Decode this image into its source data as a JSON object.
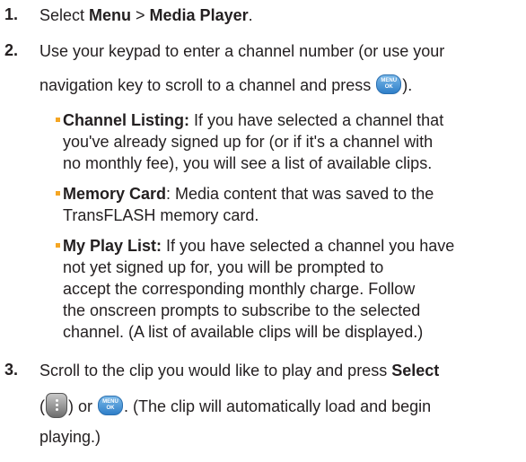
{
  "steps": [
    {
      "number": "1.",
      "lines": [
        {
          "before": "Select ",
          "bold1": "Menu",
          "mid": " > ",
          "bold2": "Media Player",
          "after": "."
        }
      ]
    },
    {
      "number": "2.",
      "line1": "Use your keypad to enter a channel number (or use your",
      "line2_before": "navigation key to scroll to a channel and press ",
      "line2_after": ")."
    },
    {
      "number": "3.",
      "line1_before": "Scroll to the clip you would like to play and press ",
      "line1_bold": "Select",
      "line2_open": "(",
      "line2_mid": ") or ",
      "line2_after": ". (The clip will automatically load and begin",
      "line3": "playing.)"
    }
  ],
  "bullets": [
    {
      "term": "Channel Listing:",
      "lines": [
        " If you have selected a channel that",
        "you've already signed up for (or if it's a channel with",
        "no monthly fee), you will see a list of available clips."
      ]
    },
    {
      "term": "Memory Card",
      "lines": [
        ": Media content that was saved to the",
        "TransFLASH memory card."
      ]
    },
    {
      "term": "My Play List:",
      "lines": [
        " If you have selected a channel you have",
        "not yet signed up for, you will be prompted to",
        "accept the corresponding monthly charge. Follow",
        "the onscreen prompts to subscribe to the selected",
        "channel. (A list of available clips will be displayed.)"
      ]
    }
  ],
  "icons": {
    "menu_ok_top": "MENU",
    "menu_ok_bottom": "OK"
  },
  "colors": {
    "bullet": "#f5a623",
    "menu_ok_button": "#3a8fd8"
  }
}
